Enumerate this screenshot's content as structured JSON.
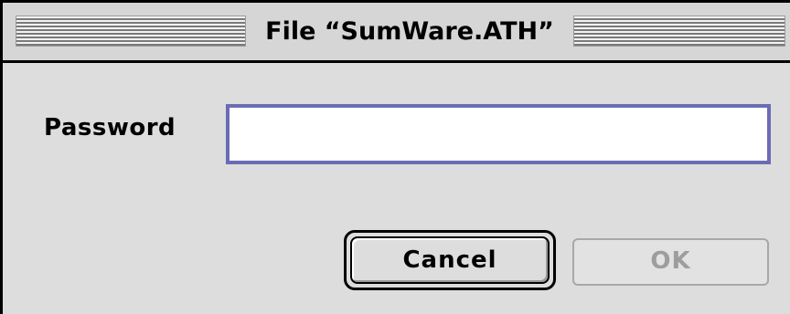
{
  "window": {
    "title": "File “SumWare.ATH”"
  },
  "form": {
    "password_label": "Password",
    "password_value": ""
  },
  "buttons": {
    "cancel_label": "Cancel",
    "ok_label": "OK",
    "ok_enabled": false
  },
  "colors": {
    "dialog_background": "#dddddd",
    "focus_ring": "#6b6bb5",
    "disabled_text": "#9d9d9d"
  }
}
